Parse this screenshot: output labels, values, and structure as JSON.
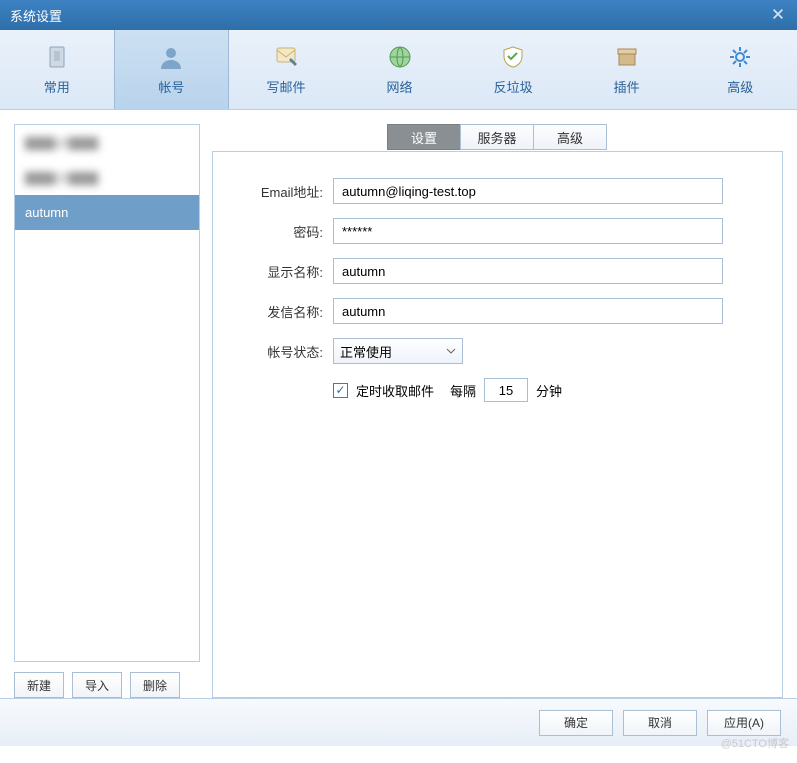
{
  "window": {
    "title": "系统设置"
  },
  "toolbar": {
    "items": [
      {
        "label": "常用"
      },
      {
        "label": "帐号"
      },
      {
        "label": "写邮件"
      },
      {
        "label": "网络"
      },
      {
        "label": "反垃圾"
      },
      {
        "label": "插件"
      },
      {
        "label": "高级"
      }
    ]
  },
  "sidebar": {
    "accounts": [
      {
        "label": "▇▇▇@▇▇▇"
      },
      {
        "label": "▇▇▇@▇▇▇"
      },
      {
        "label": "autumn"
      }
    ],
    "buttons": {
      "new": "新建",
      "import": "导入",
      "delete": "删除"
    }
  },
  "subtabs": {
    "settings": "设置",
    "server": "服务器",
    "advanced": "高级"
  },
  "form": {
    "email_label": "Email地址:",
    "email_value": "autumn@liqing-test.top",
    "password_label": "密码:",
    "password_value": "******",
    "display_label": "显示名称:",
    "display_value": "autumn",
    "sender_label": "发信名称:",
    "sender_value": "autumn",
    "status_label": "帐号状态:",
    "status_value": "正常使用",
    "timed_label": "定时收取邮件",
    "interval_pre": "每隔",
    "interval_value": "15",
    "interval_post": "分钟"
  },
  "footer": {
    "ok": "确定",
    "cancel": "取消",
    "apply": "应用(A)"
  },
  "watermark": "@51CTO博客"
}
